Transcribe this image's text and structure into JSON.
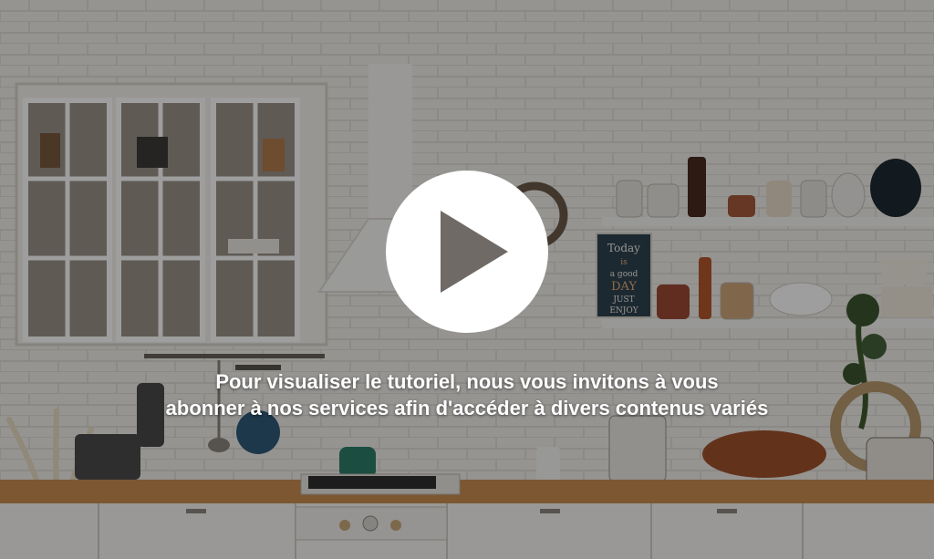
{
  "player": {
    "message_line1": "Pour visualiser le tutoriel, nous vous invitons à vous",
    "message_line2": "abonner à nos services afin d'accéder à divers contenus variés",
    "play_icon": "play-icon",
    "poster_sign_text": [
      "Today",
      "is",
      "a good",
      "DAY",
      "JUST",
      "ENJOY"
    ]
  },
  "colors": {
    "overlay": "#000000",
    "play_button_bg": "#ffffff",
    "play_triangle": "#6f6a66",
    "message_text": "#ffffff"
  }
}
